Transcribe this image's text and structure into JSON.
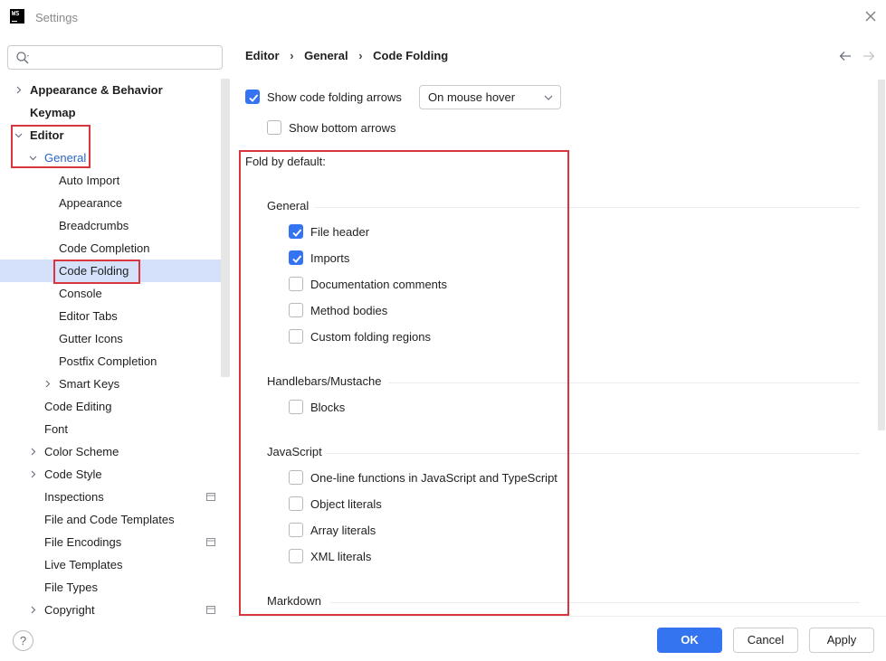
{
  "window": {
    "title": "Settings",
    "logo_text": "WS"
  },
  "search": {
    "placeholder": "",
    "value": ""
  },
  "tree": [
    {
      "label": "Appearance & Behavior",
      "bold": true,
      "expandable": true
    },
    {
      "label": "Keymap",
      "bold": true
    },
    {
      "label": "Editor",
      "bold": true,
      "expanded": true
    },
    {
      "label": "General",
      "expanded": true
    },
    {
      "label": "Auto Import"
    },
    {
      "label": "Appearance"
    },
    {
      "label": "Breadcrumbs"
    },
    {
      "label": "Code Completion"
    },
    {
      "label": "Code Folding",
      "selected": true
    },
    {
      "label": "Console"
    },
    {
      "label": "Editor Tabs"
    },
    {
      "label": "Gutter Icons"
    },
    {
      "label": "Postfix Completion"
    },
    {
      "label": "Smart Keys",
      "expandable": true
    },
    {
      "label": "Code Editing"
    },
    {
      "label": "Font"
    },
    {
      "label": "Color Scheme",
      "expandable": true
    },
    {
      "label": "Code Style",
      "expandable": true
    },
    {
      "label": "Inspections",
      "icon": true
    },
    {
      "label": "File and Code Templates"
    },
    {
      "label": "File Encodings",
      "icon": true
    },
    {
      "label": "Live Templates"
    },
    {
      "label": "File Types"
    },
    {
      "label": "Copyright",
      "expandable": true,
      "icon": true
    }
  ],
  "breadcrumb": [
    "Editor",
    "General",
    "Code Folding"
  ],
  "options": {
    "show_arrows_label": "Show code folding arrows",
    "show_arrows_checked": true,
    "arrows_mode": "On mouse hover",
    "bottom_arrows_label": "Show bottom arrows",
    "bottom_arrows_checked": false
  },
  "fold_by_default_label": "Fold by default:",
  "sections": [
    {
      "title": "General",
      "items": [
        {
          "label": "File header",
          "checked": true
        },
        {
          "label": "Imports",
          "checked": true
        },
        {
          "label": "Documentation comments",
          "checked": false
        },
        {
          "label": "Method bodies",
          "checked": false
        },
        {
          "label": "Custom folding regions",
          "checked": false
        }
      ]
    },
    {
      "title": "Handlebars/Mustache",
      "items": [
        {
          "label": "Blocks",
          "checked": false
        }
      ]
    },
    {
      "title": "JavaScript",
      "items": [
        {
          "label": "One-line functions in JavaScript and TypeScript",
          "checked": false
        },
        {
          "label": "Object literals",
          "checked": false
        },
        {
          "label": "Array literals",
          "checked": false
        },
        {
          "label": "XML literals",
          "checked": false
        }
      ]
    },
    {
      "title": "Markdown",
      "items": []
    }
  ],
  "buttons": {
    "ok": "OK",
    "cancel": "Cancel",
    "apply": "Apply",
    "help": "?"
  },
  "colors": {
    "accent": "#3574f0",
    "highlight": "#d5e1fa",
    "annotation": "#d9363e",
    "link": "#2b64c6"
  }
}
